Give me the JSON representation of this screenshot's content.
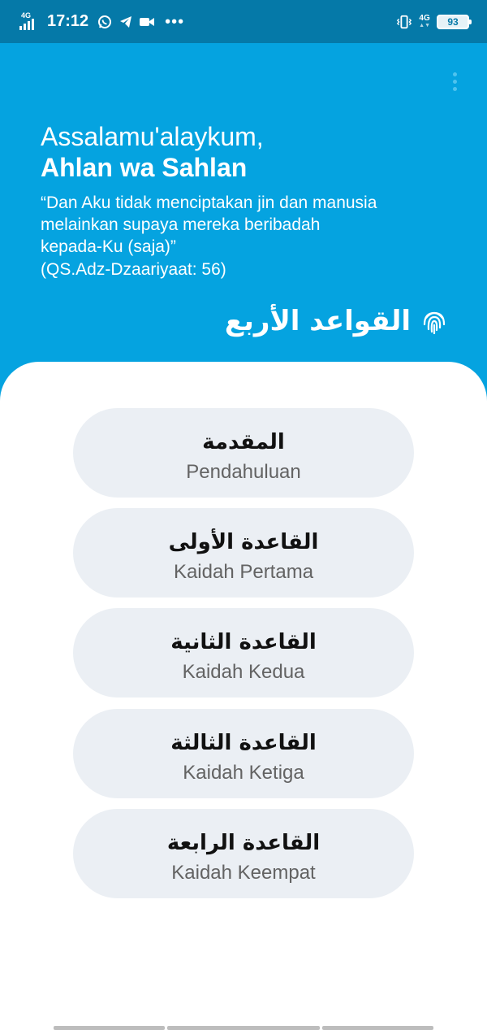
{
  "status_bar": {
    "network_left": "4G",
    "time": "17:12",
    "network_right": "4G",
    "battery": "93"
  },
  "header": {
    "greeting": "Assalamu'alaykum,",
    "greeting_bold": "Ahlan wa Sahlan",
    "quote": "“Dan Aku tidak menciptakan jin dan manusia melainkan supaya mereka beribadah kepada-Ku (saja)”",
    "quote_ref": "(QS.Adz-Dzaariyaat: 56)",
    "brand_title": "القواعد الأربع"
  },
  "menu": [
    {
      "arabic": "المقدمة",
      "label": "Pendahuluan"
    },
    {
      "arabic": "القاعدة الأولى",
      "label": "Kaidah Pertama"
    },
    {
      "arabic": "القاعدة الثانية",
      "label": "Kaidah Kedua"
    },
    {
      "arabic": "القاعدة الثالثة",
      "label": "Kaidah Ketiga"
    },
    {
      "arabic": "القاعدة الرابعة",
      "label": "Kaidah Keempat"
    }
  ],
  "colors": {
    "status_bar": "#0579A8",
    "header": "#05A3E0",
    "card": "#EBEFF4",
    "card_subtitle": "#636363"
  }
}
